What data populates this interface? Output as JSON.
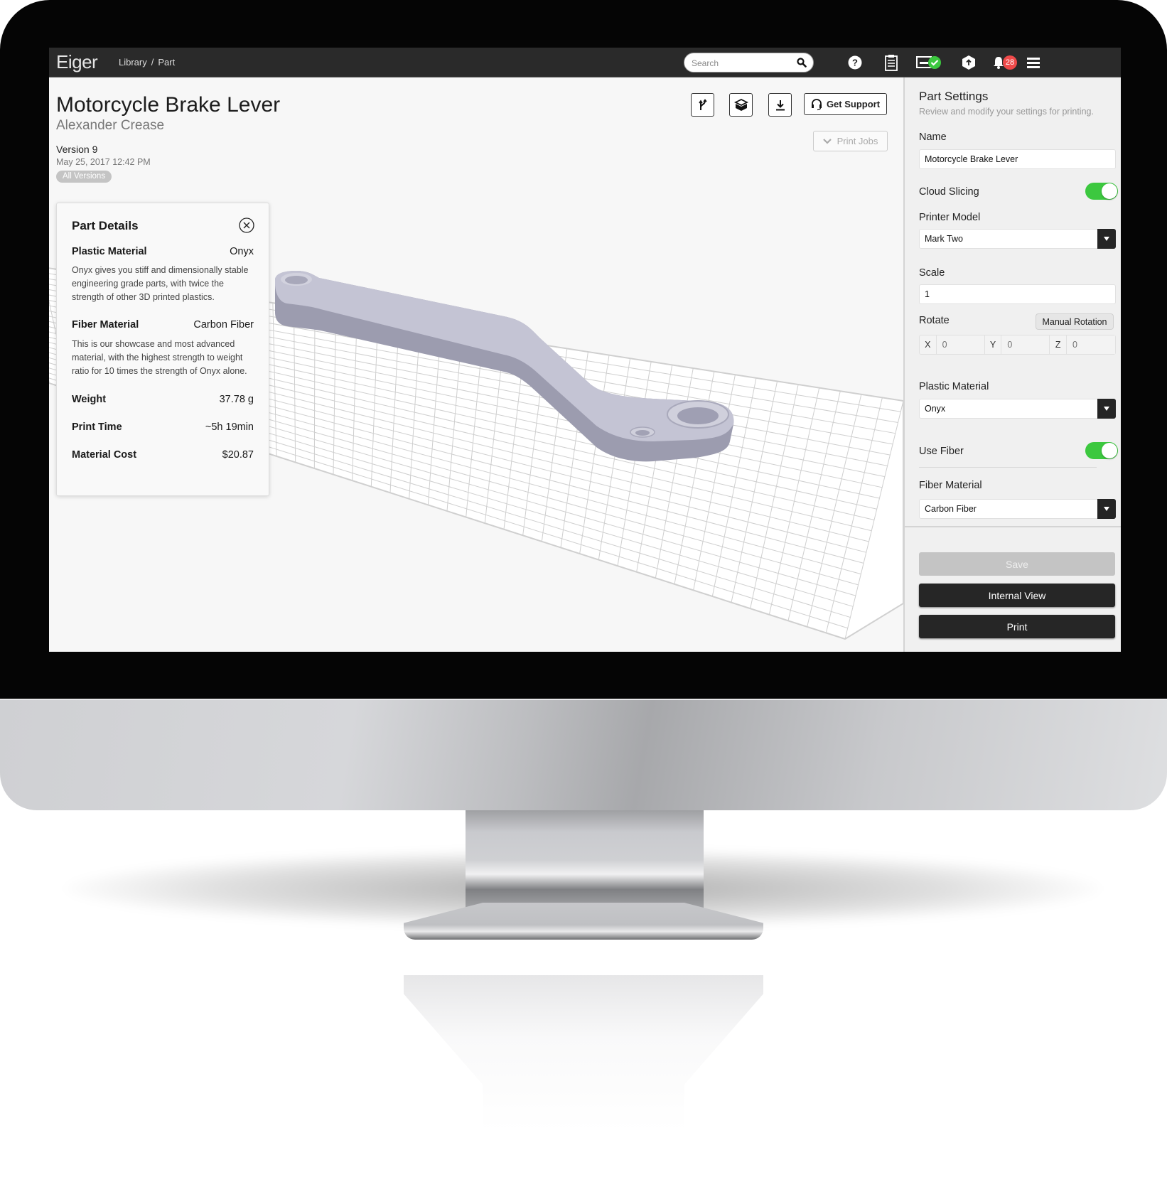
{
  "app": {
    "logo": "Eiger"
  },
  "breadcrumb": [
    {
      "label": "Library"
    },
    {
      "label": "Part"
    }
  ],
  "breadcrumb_separator": "/",
  "search": {
    "placeholder": "Search",
    "value": ""
  },
  "header_icons": {
    "help": "help-icon",
    "clipboard": "clipboard-icon",
    "printer_status": "printer-status-icon",
    "upload": "upload-icon",
    "notifications": "bell-icon",
    "notification_count": "28",
    "menu": "hamburger-menu-icon"
  },
  "colors": {
    "topbar": "#2a2a2a",
    "toggle_on": "#3cc83f",
    "badge": "#ef4a4a",
    "status_ok": "#3cc83f",
    "dark_button": "#262626",
    "part_color": "#bcbccb"
  },
  "part": {
    "title": "Motorcycle Brake Lever",
    "author": "Alexander Crease",
    "version": "Version 9",
    "date": "May 25, 2017 12:42 PM",
    "all_versions": "All Versions"
  },
  "toolbar": {
    "branch_icon": "branch-icon",
    "layers_icon": "layers-box-icon",
    "download_icon": "download-icon",
    "support_label": "Get Support",
    "print_jobs_label": "Print Jobs"
  },
  "details": {
    "title": "Part Details",
    "plastic": {
      "label": "Plastic Material",
      "value": "Onyx",
      "desc": "Onyx gives you stiff and dimensionally stable engineering grade parts, with twice the strength of other 3D printed plastics."
    },
    "fiber": {
      "label": "Fiber Material",
      "value": "Carbon Fiber",
      "desc": "This is our showcase and most advanced material, with the highest strength to weight ratio for 10 times the strength of Onyx alone."
    },
    "weight": {
      "label": "Weight",
      "value": "37.78 g"
    },
    "print_time": {
      "label": "Print Time",
      "value": "~5h 19min"
    },
    "cost": {
      "label": "Material Cost",
      "value": "$20.87"
    }
  },
  "settings": {
    "title": "Part Settings",
    "subtitle": "Review and modify your settings for printing.",
    "name_label": "Name",
    "name_value": "Motorcycle Brake Lever",
    "cloud_slicing_label": "Cloud Slicing",
    "cloud_slicing_on": true,
    "printer_model_label": "Printer Model",
    "printer_model_value": "Mark Two",
    "scale_label": "Scale",
    "scale_value": "1",
    "rotate_label": "Rotate",
    "manual_rotation_label": "Manual Rotation",
    "rotate": {
      "x_label": "X",
      "x_placeholder": "0",
      "y_label": "Y",
      "y_placeholder": "0",
      "z_label": "Z",
      "z_placeholder": "0"
    },
    "plastic_label": "Plastic Material",
    "plastic_value": "Onyx",
    "use_fiber_label": "Use Fiber",
    "use_fiber_on": true,
    "fiber_label": "Fiber Material",
    "fiber_value": "Carbon Fiber",
    "save_label": "Save",
    "internal_view_label": "Internal View",
    "print_label": "Print"
  }
}
